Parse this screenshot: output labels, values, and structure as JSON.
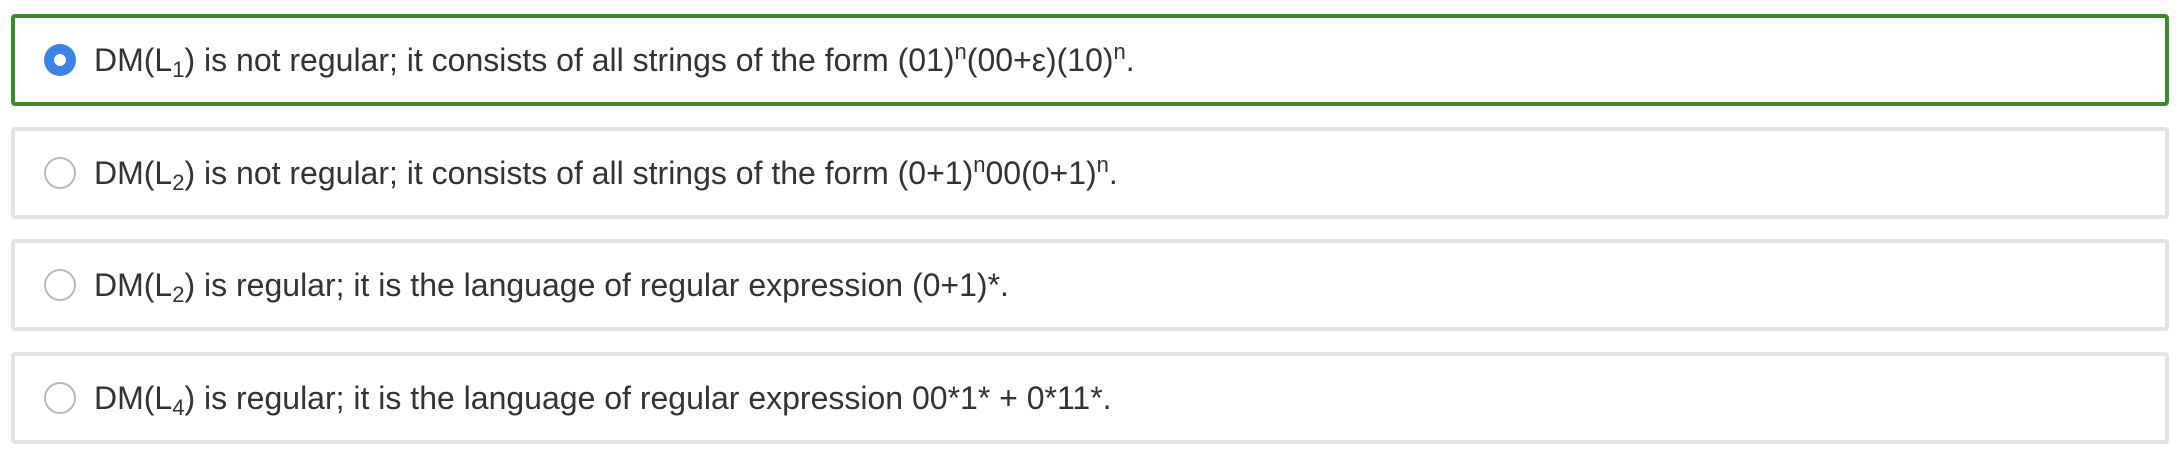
{
  "options": [
    {
      "selected": true,
      "prefix": "DM(L",
      "sub": "1",
      "text_a": ") is not regular; it consists of all strings of the form (01)",
      "sup_a": "n",
      "text_b": "(00+ε)(10)",
      "sup_b": "n",
      "text_c": "."
    },
    {
      "selected": false,
      "prefix": "DM(L",
      "sub": "2",
      "text_a": ") is not regular; it consists of all strings of the form (0+1)",
      "sup_a": "n",
      "text_b": "00(0+1)",
      "sup_b": "n",
      "text_c": "."
    },
    {
      "selected": false,
      "prefix": "DM(L",
      "sub": "2",
      "text_a": ") is regular; it is the language of regular expression (0+1)*."
    },
    {
      "selected": false,
      "prefix": "DM(L",
      "sub": "4",
      "text_a": ") is regular; it is the language of regular expression 00*1* + 0*11*."
    }
  ],
  "colors": {
    "selected_border": "#3c8a2e",
    "default_border": "#e3e3e3",
    "radio_checked": "#3b82ec",
    "text": "#333333"
  }
}
